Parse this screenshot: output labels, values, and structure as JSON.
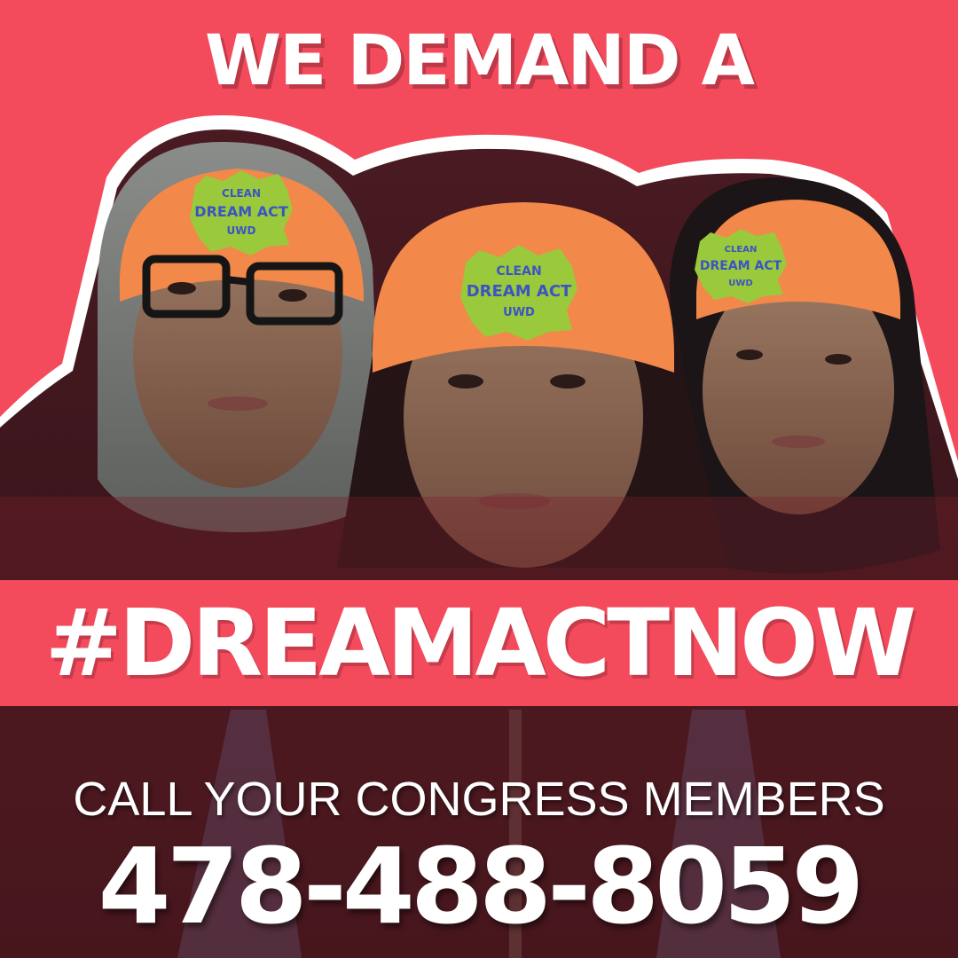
{
  "poster": {
    "headline": "WE DEMAND A",
    "hashtag": "#DREAMACTNOW",
    "call_to_action": "CALL YOUR CONGRESS MEMBERS",
    "phone": "478-488-8059",
    "hat_patch_text": [
      "CLEAN",
      "DREAM ACT",
      "UWD"
    ]
  },
  "colors": {
    "brand_red": "#f34a5c",
    "hat_orange": "#f2884a",
    "text_white": "#ffffff"
  }
}
